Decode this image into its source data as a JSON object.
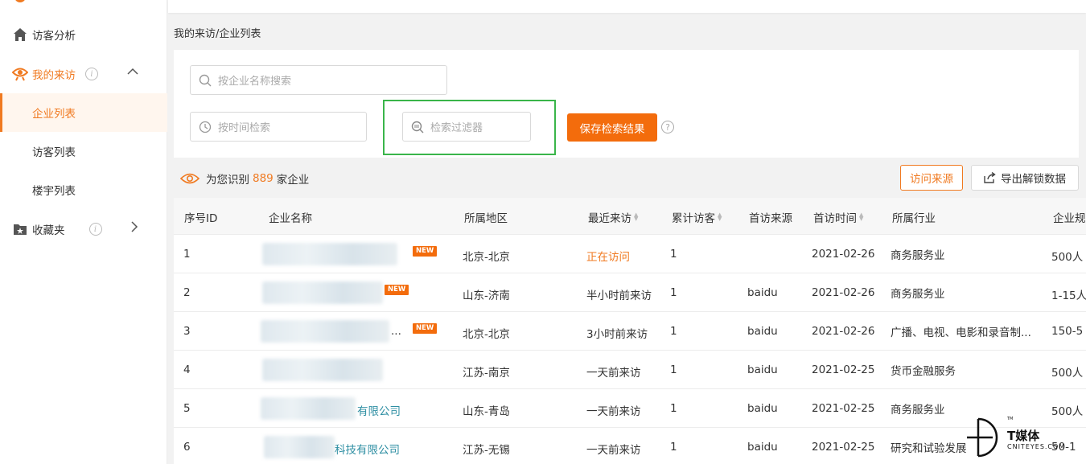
{
  "sidebar": {
    "items": [
      {
        "label": "访客分析",
        "icon": "home-icon"
      },
      {
        "label": "我的来访",
        "icon": "eye-icon",
        "active": true
      },
      {
        "label": "收藏夹",
        "icon": "folder-star-icon"
      }
    ],
    "sub_items": [
      {
        "label": "企业列表",
        "selected": true
      },
      {
        "label": "访客列表"
      },
      {
        "label": "楼宇列表"
      }
    ],
    "info_glyph": "i"
  },
  "breadcrumb": "我的来访/企业列表",
  "filters": {
    "company_search_placeholder": "按企业名称搜索",
    "time_search_placeholder": "按时间检索",
    "filter_placeholder": "检索过滤器",
    "save_button": "保存检索结果",
    "help_glyph": "?"
  },
  "summary": {
    "prefix": "为您识别",
    "count": "889",
    "suffix": "家企业",
    "visit_source_button": "访问来源",
    "export_button": "导出解锁数据"
  },
  "table": {
    "headers": [
      "序号ID",
      "企业名称",
      "所属地区",
      "最近来访",
      "累计访客",
      "首访来源",
      "首访时间",
      "所属行业",
      "企业规"
    ],
    "badge": "NEW",
    "rows": [
      {
        "id": "1",
        "name_suffix": "",
        "new": true,
        "region": "北京-北京",
        "recent": "正在访问",
        "recent_active": true,
        "visitors": "1",
        "source": "",
        "first_time": "2021-02-26",
        "industry": "商务服务业",
        "scale": "500人"
      },
      {
        "id": "2",
        "name_suffix": "",
        "new": true,
        "region": "山东-济南",
        "recent": "半小时前来访",
        "recent_active": false,
        "visitors": "1",
        "source": "baidu",
        "first_time": "2021-02-26",
        "industry": "商务服务业",
        "scale": "1-15人"
      },
      {
        "id": "3",
        "name_suffix": "...",
        "new": true,
        "region": "北京-北京",
        "recent": "3小时前来访",
        "recent_active": false,
        "visitors": "1",
        "source": "baidu",
        "first_time": "2021-02-26",
        "industry": "广播、电视、电影和录音制...",
        "scale": "150-5"
      },
      {
        "id": "4",
        "name_suffix": "",
        "new": false,
        "region": "江苏-南京",
        "recent": "一天前来访",
        "recent_active": false,
        "visitors": "1",
        "source": "baidu",
        "first_time": "2021-02-25",
        "industry": "货币金融服务",
        "scale": "500人"
      },
      {
        "id": "5",
        "name_suffix": "有限公司",
        "new": false,
        "region": "山东-青岛",
        "recent": "一天前来访",
        "recent_active": false,
        "visitors": "1",
        "source": "baidu",
        "first_time": "2021-02-25",
        "industry": "商务服务业",
        "scale": "500人"
      },
      {
        "id": "6",
        "name_suffix": "科技有限公司",
        "new": false,
        "region": "江苏-无锡",
        "recent": "一天前来访",
        "recent_active": false,
        "visitors": "1",
        "source": "baidu",
        "first_time": "2021-02-25",
        "industry": "研究和试验发展",
        "scale": "50-1"
      }
    ]
  },
  "watermark": {
    "title": "T媒体",
    "subtitle": "CNITEYES.COM",
    "tm": "TM"
  },
  "colors": {
    "accent": "#f07a21",
    "button": "#f36c0c",
    "highlight_box": "#3ab54a",
    "link": "#2f8fa3"
  }
}
